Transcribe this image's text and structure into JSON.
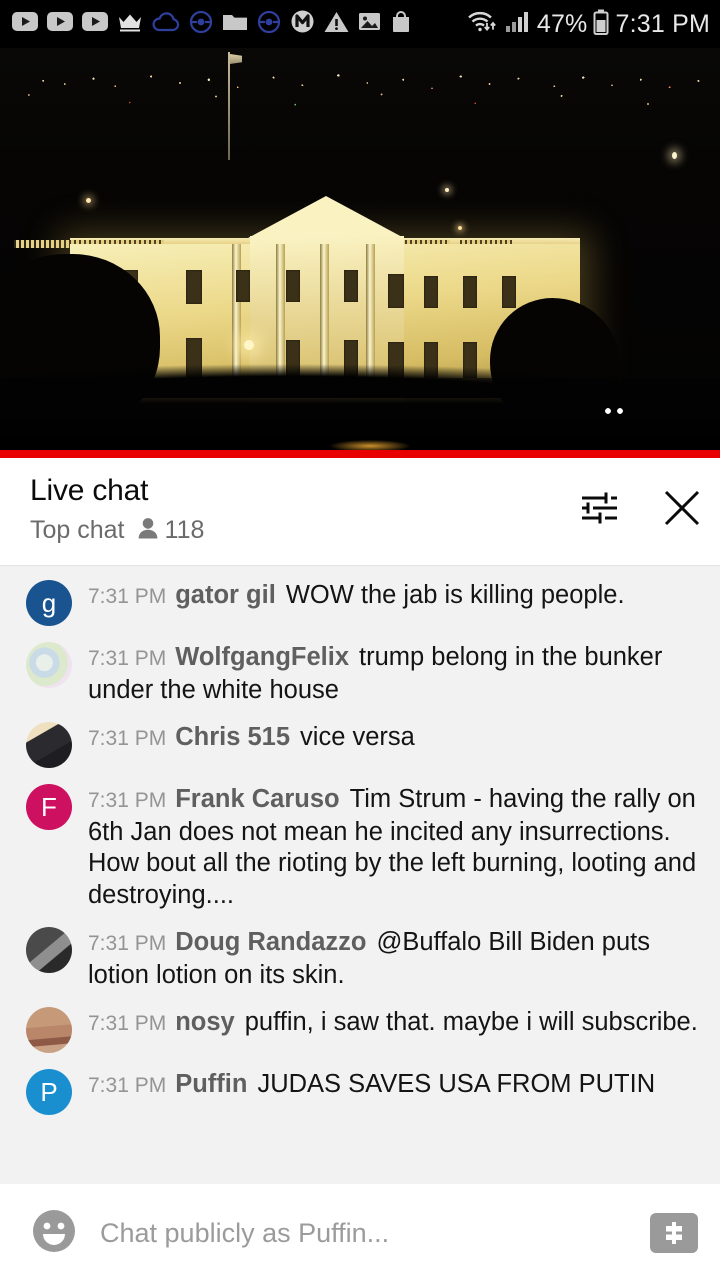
{
  "status_bar": {
    "battery_percent": "47%",
    "time": "7:31 PM",
    "icons": [
      "youtube-icon",
      "youtube-icon",
      "youtube-icon",
      "crown-icon",
      "cloud-icon",
      "pokeball-icon",
      "folder-icon",
      "pokeball-icon",
      "m-circle-icon",
      "warning-triangle-icon",
      "image-icon",
      "shopping-bag-icon"
    ],
    "right_icons": [
      "wifi-icon",
      "cellular-signal-icon",
      "battery-icon"
    ]
  },
  "video": {
    "description": "White House at night",
    "progress_color": "#e80000"
  },
  "chat_header": {
    "title": "Live chat",
    "subtitle": "Top chat",
    "viewer_count": "118",
    "settings_icon": "tune-icon",
    "close_icon": "close-icon"
  },
  "messages": [
    {
      "timestamp": "7:31 PM",
      "author": "gator gil",
      "text": "WOW the jab is killing people.",
      "avatar_type": "letter",
      "avatar_letter": "g",
      "avatar_color": "#1a5490"
    },
    {
      "timestamp": "7:31 PM",
      "author": "WolfgangFelix",
      "text": "trump belong in the bunker under the white house",
      "avatar_type": "photo",
      "avatar_class": "av-pastel",
      "avatar_letter": "",
      "avatar_color": "#dfe7df"
    },
    {
      "timestamp": "7:31 PM",
      "author": "Chris 515",
      "text": "vice versa",
      "avatar_type": "photo",
      "avatar_class": "av-sunglasses",
      "avatar_letter": "",
      "avatar_color": "#2b2b2f"
    },
    {
      "timestamp": "7:31 PM",
      "author": "Frank Caruso",
      "text": "Tim Strum - having the rally on 6th Jan does not mean he incited any insurrections. How bout all the rioting by the left burning, looting and destroying....",
      "avatar_type": "letter",
      "avatar_letter": "F",
      "avatar_color": "#ce1060"
    },
    {
      "timestamp": "7:31 PM",
      "author": "Doug Randazzo",
      "text": "@Buffalo Bill Biden puts lotion lotion on its skin.",
      "avatar_type": "photo",
      "avatar_class": "av-gray",
      "avatar_letter": "",
      "avatar_color": "#7a7a7a"
    },
    {
      "timestamp": "7:31 PM",
      "author": "nosy",
      "text": "puffin, i saw that. maybe i will subscribe.",
      "avatar_type": "photo",
      "avatar_class": "av-nose",
      "avatar_letter": "",
      "avatar_color": "#b9866a"
    },
    {
      "timestamp": "7:31 PM",
      "author": "Puffin",
      "text": "JUDAS SAVES USA FROM PUTIN",
      "avatar_type": "letter",
      "avatar_letter": "P",
      "avatar_color": "#1a8fd0"
    }
  ],
  "input_bar": {
    "emoji_icon": "emoji-smiley-icon",
    "placeholder": "Chat publicly as Puffin...",
    "superchat_icon": "dollar-superchat-icon"
  }
}
